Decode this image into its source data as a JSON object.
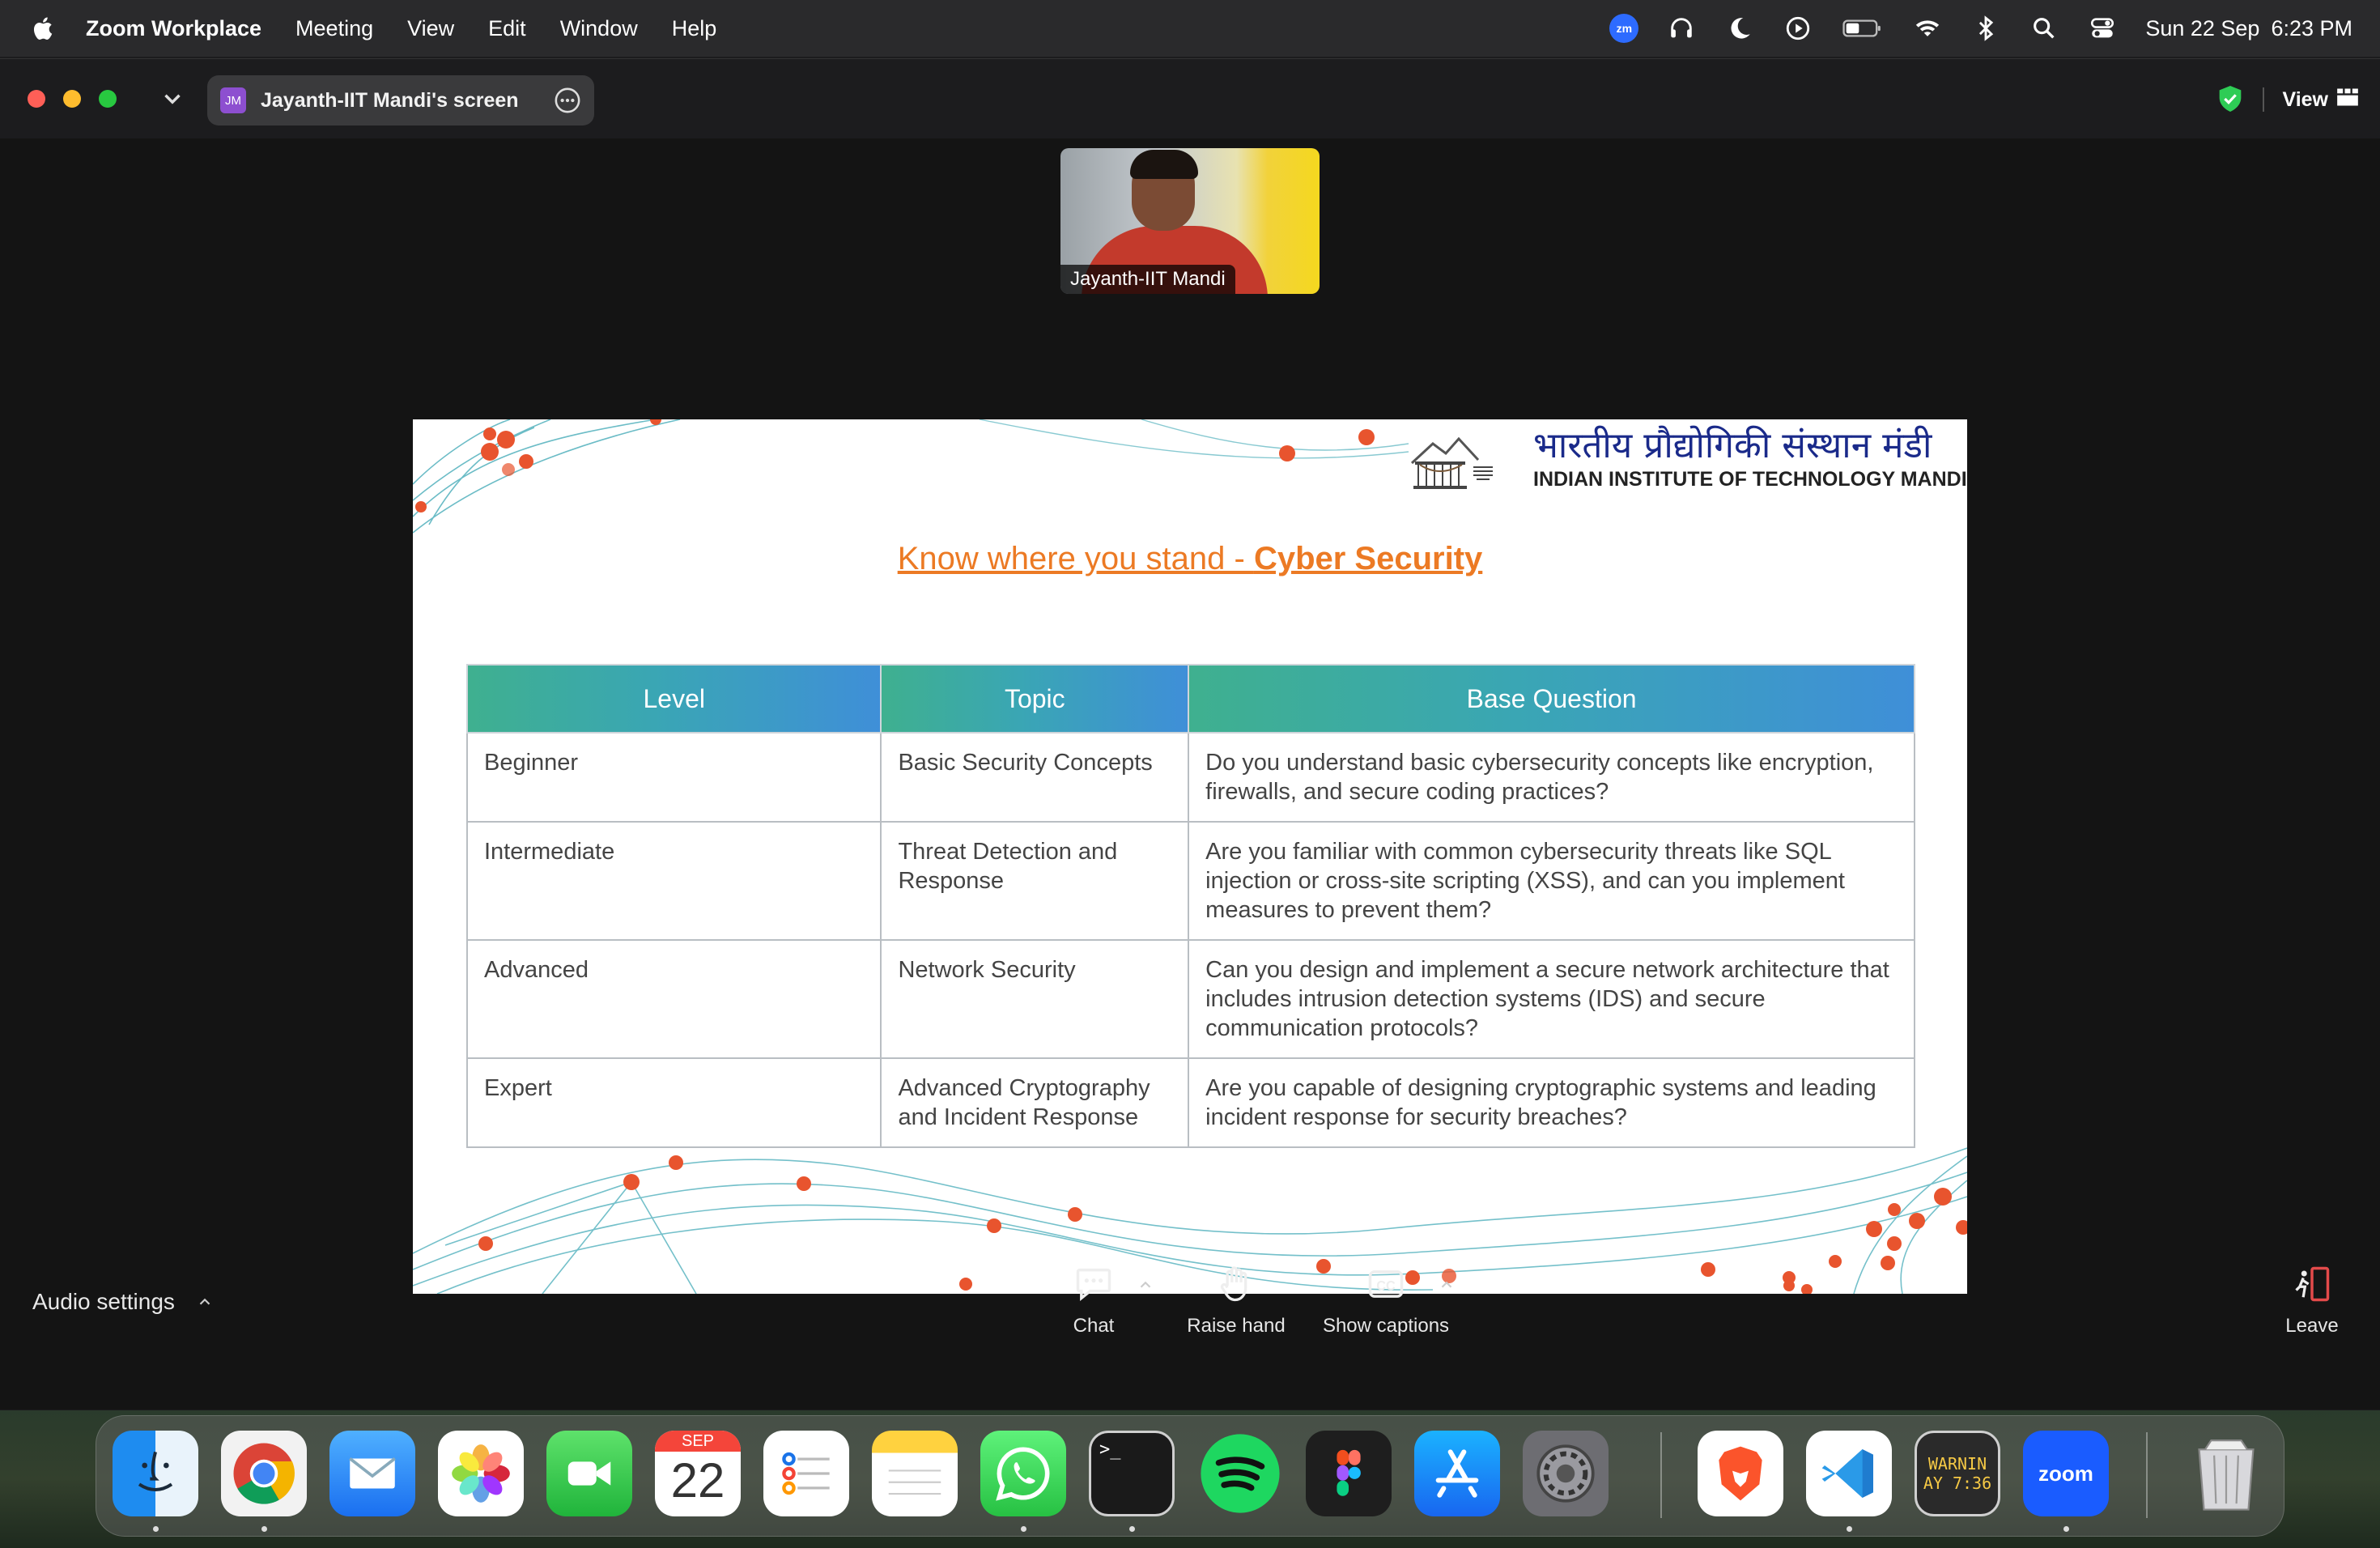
{
  "menubar": {
    "app_name": "Zoom Workplace",
    "menus": [
      "Meeting",
      "View",
      "Edit",
      "Window",
      "Help"
    ],
    "zoom_badge": "zm",
    "date": "Sun 22 Sep",
    "time": "6:23 PM",
    "status_icons": [
      "headphones-icon",
      "moon-icon",
      "play-circle-icon",
      "battery-icon",
      "wifi-icon",
      "bluetooth-icon",
      "search-icon",
      "control-center-icon"
    ]
  },
  "window": {
    "share_initials": "JM",
    "share_label": "Jayanth-IIT Mandi's screen",
    "view_label": "View",
    "colors": {
      "close": "#ff5f57",
      "minimize": "#febc2e",
      "zoom": "#28c840",
      "shield": "#2ecc55",
      "jm_badge": "#8d4fd0"
    }
  },
  "participant": {
    "name": "Jayanth-IIT Mandi"
  },
  "slide": {
    "institute_hindi": "भारतीय प्रौद्योगिकी संस्थान मंडी",
    "institute_english": "INDIAN INSTITUTE OF TECHNOLOGY MANDI",
    "title_prefix": "Know where you stand - ",
    "title_bold": "Cyber Security",
    "colors": {
      "title": "#ec7a24",
      "header_start": "#3fb08f",
      "header_end": "#3f8fd8",
      "dots": "#e8542e",
      "lines": "#3aa6b4"
    },
    "table": {
      "headers": [
        "Level",
        "Topic",
        "Base Question"
      ],
      "rows": [
        [
          "Beginner",
          "Basic Security Concepts",
          "Do you understand basic cybersecurity concepts like encryption, firewalls, and secure coding practices?"
        ],
        [
          "Intermediate",
          "Threat Detection and Response",
          "Are you familiar with common cybersecurity threats like SQL injection or cross-site scripting (XSS), and can you implement measures to prevent them?"
        ],
        [
          "Advanced",
          "Network Security",
          "Can you design and implement a secure network architecture that includes intrusion detection systems (IDS) and secure communication protocols?"
        ],
        [
          "Expert",
          "Advanced Cryptography and Incident Response",
          "Are you capable of designing cryptographic systems and leading incident response for security breaches?"
        ]
      ]
    }
  },
  "controls": {
    "audio_settings": "Audio settings",
    "chat": "Chat",
    "raise_hand": "Raise hand",
    "show_captions": "Show captions",
    "leave": "Leave"
  },
  "dock": {
    "apps": [
      "Finder",
      "Google Chrome",
      "Mail",
      "Photos",
      "FaceTime",
      "Calendar",
      "Reminders",
      "Notes",
      "WhatsApp",
      "Terminal",
      "Spotify",
      "Figma",
      "App Store",
      "System Settings",
      "Brave",
      "Visual Studio Code",
      "Console",
      "Zoom",
      "Trash"
    ],
    "calendar_month": "SEP",
    "calendar_day": "22",
    "console_text_1": "WARNIN",
    "console_text_2": "AY 7:36",
    "zoom_text": "zoom",
    "terminal_prompt": ">_"
  }
}
